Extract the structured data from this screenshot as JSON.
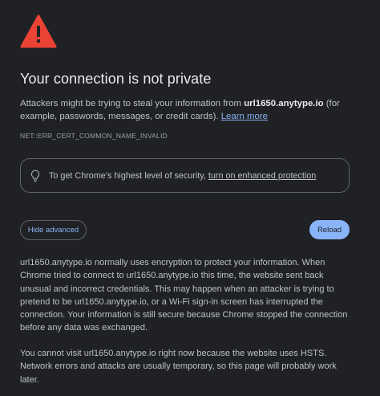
{
  "icons": {
    "warning": "warning-triangle-icon",
    "bulb": "lightbulb-icon"
  },
  "colors": {
    "background": "#202124",
    "warning_red": "#ea4335",
    "link_blue": "#8ab4f8",
    "title": "#e8eaed",
    "body_text": "#bdc1c6"
  },
  "header": {
    "title": "Your connection is not private"
  },
  "description": {
    "prefix": "Attackers might be trying to steal your information from ",
    "host": "url1650.anytype.io",
    "suffix": " (for example, passwords, messages, or credit cards). ",
    "learn_more": "Learn more"
  },
  "error_code": "NET::ERR_CERT_COMMON_NAME_INVALID",
  "protection": {
    "text": "To get Chrome’s highest level of security, ",
    "link": "turn on enhanced protection"
  },
  "buttons": {
    "hide_advanced": "Hide advanced",
    "reload": "Reload"
  },
  "details": {
    "paragraph1": "url1650.anytype.io normally uses encryption to protect your information. When Chrome tried to connect to url1650.anytype.io this time, the website sent back unusual and incorrect credentials. This may happen when an attacker is trying to pretend to be url1650.anytype.io, or a Wi-Fi sign-in screen has interrupted the connection. Your information is still secure because Chrome stopped the connection before any data was exchanged.",
    "paragraph2": "You cannot visit url1650.anytype.io right now because the website uses HSTS. Network errors and attacks are usually temporary, so this page will probably work later."
  }
}
